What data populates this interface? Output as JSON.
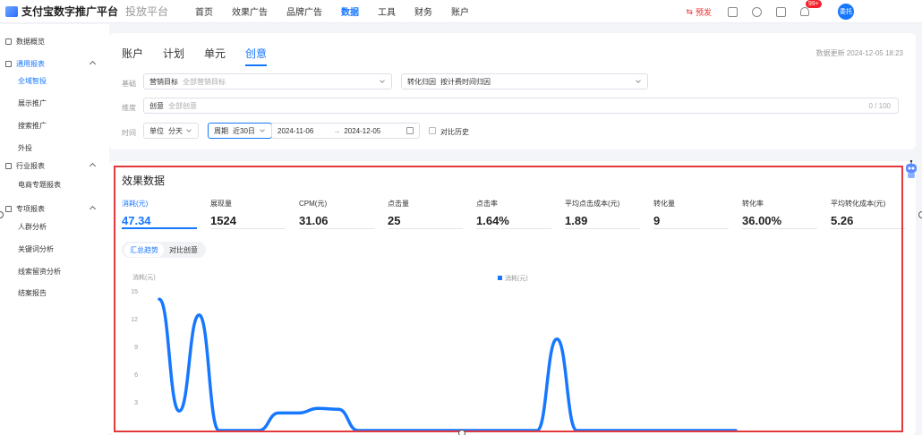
{
  "app": {
    "title": "支付宝数字推广平台",
    "subtitle": "投放平台"
  },
  "nav": [
    "首页",
    "效果广告",
    "品牌广告",
    "数据",
    "工具",
    "财务",
    "账户"
  ],
  "nav_active": 3,
  "topbar": {
    "warn_label": "预发",
    "bell_badge": "99+",
    "avatar_text": "委托"
  },
  "sidebar": {
    "items": [
      {
        "label": "数据概览",
        "level": 0,
        "icon": "dashboard-icon"
      },
      {
        "label": "通用报表",
        "level": 0,
        "icon": "bar-chart-icon",
        "active": true,
        "expanded": true
      },
      {
        "label": "全域智投",
        "level": 1,
        "active": true
      },
      {
        "label": "展示推广",
        "level": 1
      },
      {
        "label": "搜索推广",
        "level": 1
      },
      {
        "label": "外投",
        "level": 1
      },
      {
        "label": "行业报表",
        "level": 0,
        "icon": "line-chart-icon",
        "expanded": true
      },
      {
        "label": "电商专题报表",
        "level": 1
      },
      {
        "label": "专项报表",
        "level": 0,
        "icon": "pie-chart-icon",
        "expanded": true
      },
      {
        "label": "人群分析",
        "level": 1
      },
      {
        "label": "关键词分析",
        "level": 1
      },
      {
        "label": "线索留资分析",
        "level": 1
      },
      {
        "label": "结案报告",
        "level": 1
      }
    ]
  },
  "filters": {
    "tabs": [
      "账户",
      "计划",
      "单元",
      "创意"
    ],
    "active_tab": 3,
    "updated": "数据更新 2024-12-05 18:23",
    "basic_label": "基础",
    "goal_key": "营销目标",
    "goal_value": "全部营销目标",
    "attr_key": "转化归因",
    "attr_value": "按计费时间归因",
    "dim_label": "维度",
    "creative_key": "创意",
    "creative_placeholder": "全部创意",
    "creative_count": "0 / 100",
    "time_label": "时间",
    "unit_key": "单位",
    "unit_value": "分天",
    "period_key": "周期",
    "period_value": "近30日",
    "date_start": "2024-11-06",
    "date_arrow": "→",
    "date_end": "2024-12-05",
    "compare_label": "对比历史"
  },
  "effect": {
    "title": "效果数据",
    "metrics": [
      {
        "label": "消耗(元)",
        "value": "47.34",
        "active": true
      },
      {
        "label": "展现量",
        "value": "1524"
      },
      {
        "label": "CPM(元)",
        "value": "31.06"
      },
      {
        "label": "点击量",
        "value": "25"
      },
      {
        "label": "点击率",
        "value": "1.64%"
      },
      {
        "label": "平均点击成本(元)",
        "value": "1.89"
      },
      {
        "label": "转化量",
        "value": "9"
      },
      {
        "label": "转化率",
        "value": "36.00%"
      },
      {
        "label": "平均转化成本(元)",
        "value": "5.26"
      }
    ],
    "toggle": [
      "汇总趋势",
      "对比创意"
    ],
    "toggle_active": 0
  },
  "chart_data": {
    "type": "line",
    "ylabel": "消耗(元)",
    "legend": "消耗(元)",
    "legend_position": "top-center",
    "y_ticks": [
      15,
      12,
      9,
      6,
      3
    ],
    "ylim": [
      0,
      15
    ],
    "grid": false,
    "series": [
      {
        "name": "消耗(元)",
        "color": "#1677ff",
        "values": [
          14.2,
          2.1,
          12.5,
          0,
          0,
          0,
          1.9,
          1.9,
          2.4,
          2.3,
          0,
          0,
          0,
          0,
          0,
          0,
          0,
          0,
          0,
          0,
          9.9,
          0,
          0,
          0,
          0,
          0,
          0,
          0,
          0,
          0
        ]
      }
    ]
  },
  "colors": {
    "accent": "#1677ff",
    "highlight_border": "#e4393c",
    "badge": "#f5222d"
  }
}
